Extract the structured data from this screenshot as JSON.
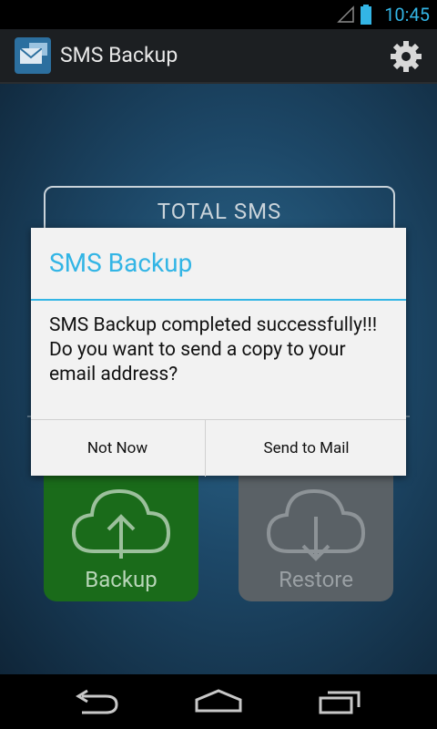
{
  "status_bar": {
    "time": "10:45"
  },
  "action_bar": {
    "title": "SMS Backup"
  },
  "main": {
    "total_label": "TOTAL SMS",
    "backup_label": "Backup",
    "restore_label": "Restore"
  },
  "dialog": {
    "title": "SMS Backup",
    "message": "SMS Backup completed successfully!!! Do you want to send a copy to your email address?",
    "negative_label": "Not Now",
    "positive_label": "Send to Mail"
  },
  "colors": {
    "accent": "#33b5e5",
    "backup_tile": "#1a6b1a",
    "restore_tile": "#5a6166"
  },
  "icons": [
    "signal-icon",
    "battery-icon",
    "app-icon",
    "settings-gear-icon",
    "cloud-upload-icon",
    "cloud-download-icon",
    "back-icon",
    "home-icon",
    "recents-icon"
  ]
}
